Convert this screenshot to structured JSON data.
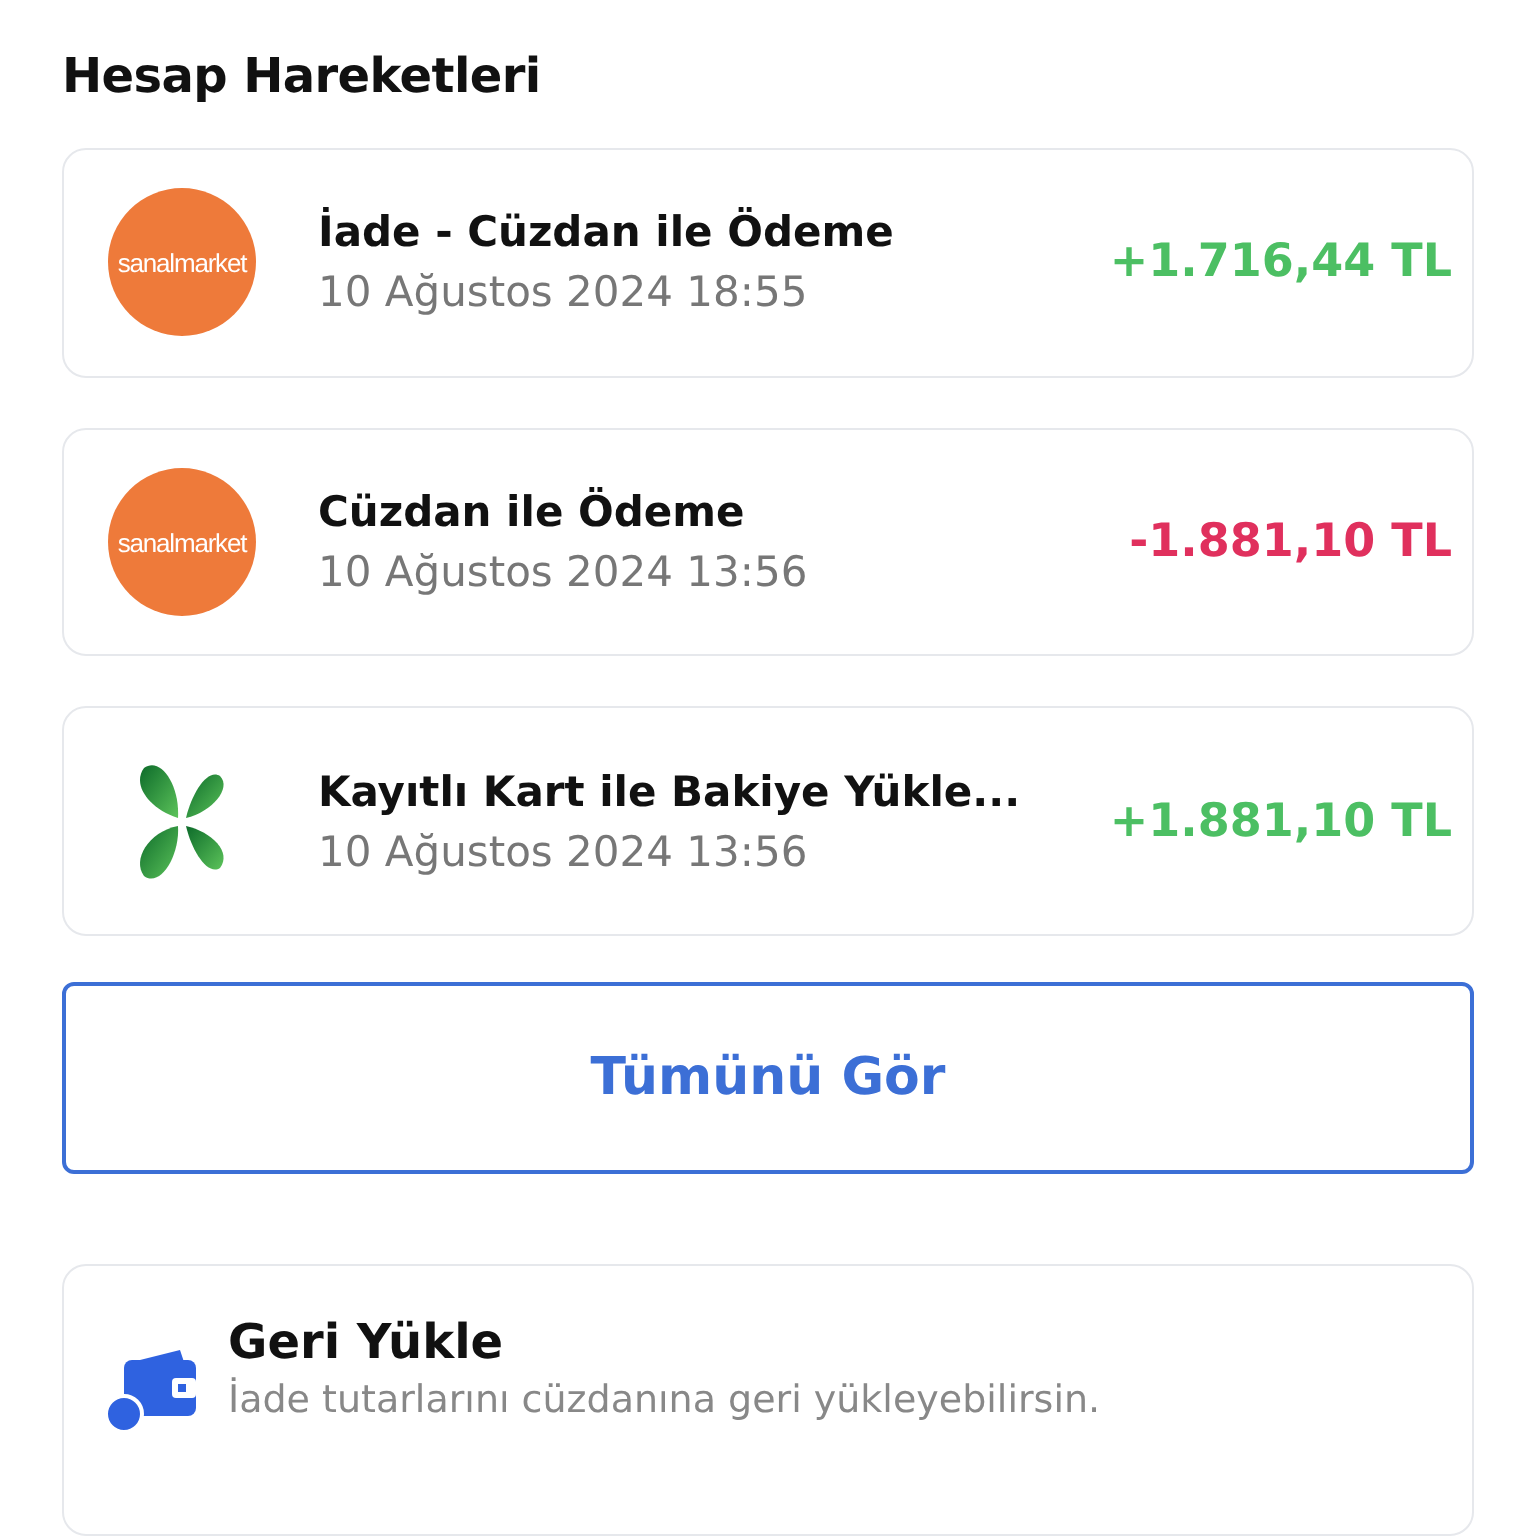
{
  "title": "Hesap Hareketleri",
  "transactions": [
    {
      "logo": {
        "kind": "sanalmarket",
        "text": "sanalmarket"
      },
      "name": "İade - Cüzdan ile Ödeme",
      "date": "10 Ağustos 2024 18:55",
      "amount": "+1.716,44 TL",
      "color": "#4cbf63"
    },
    {
      "logo": {
        "kind": "sanalmarket",
        "text": "sanalmarket"
      },
      "name": "Cüzdan ile Ödeme",
      "date": "10 Ağustos 2024 13:56",
      "amount": "-1.881,10 TL",
      "color": "#e0305d"
    },
    {
      "logo": {
        "kind": "clover"
      },
      "name": "Kayıtlı Kart ile Bakiye Yükle...",
      "date": "10 Ağustos 2024 13:56",
      "amount": "+1.881,10 TL",
      "color": "#4cbf63"
    }
  ],
  "see_all_button": "Tümünü Gör",
  "refund_card": {
    "title": "Geri Yükle",
    "description": "İade tutarlarını cüzdanına geri yükleyebilirsin."
  }
}
